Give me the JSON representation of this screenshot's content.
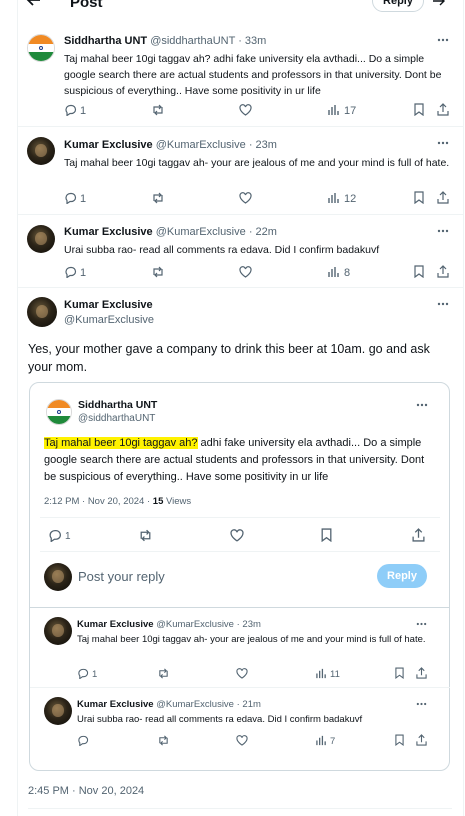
{
  "header": {
    "title": "Post",
    "reply_button": "Reply"
  },
  "tweets": [
    {
      "name": "Siddhartha UNT",
      "handle": "@siddharthaUNT",
      "time": "· 33m",
      "text": "Taj mahal beer 10gi taggav ah? adhi fake university ela avthadi... Do a simple google search there are actual students and professors in that university. Dont be suspicious of everything..  Have some positivity in ur life",
      "replies": "1",
      "views": "17"
    },
    {
      "name": "Kumar Exclusive",
      "handle": "@KumarExclusive",
      "time": "· 23m",
      "text": "Taj mahal beer 10gi taggav ah- your are jealous of me and your mind is full of hate.",
      "replies": "1",
      "views": "12"
    },
    {
      "name": "Kumar Exclusive",
      "handle": "@KumarExclusive",
      "time": "· 22m",
      "text": "Urai subba rao- read all comments ra edava. Did I confirm badakuvf",
      "replies": "1",
      "views": "8"
    }
  ],
  "main_post": {
    "name": "Kumar Exclusive",
    "handle": "@KumarExclusive",
    "text": "Yes, your mother gave a company to drink this beer at 10am. go and ask your mom.",
    "timestamp": "2:45 PM · Nov 20, 2024"
  },
  "quoted": {
    "name": "Siddhartha UNT",
    "handle": "@siddharthaUNT",
    "highlight": "Taj mahal beer 10gi taggav ah?",
    "text_rest": " adhi fake university ela avthadi... Do a simple google search there are actual students and professors in that university. Dont be suspicious of everything..  Have some positivity in ur life",
    "time": "2:12 PM · Nov 20, 2024 · ",
    "views_count": "15",
    "views_label": " Views",
    "replies": "1",
    "reply_placeholder": "Post your reply",
    "reply_button": "Reply"
  },
  "nested_replies": [
    {
      "name": "Kumar Exclusive",
      "handle": "@KumarExclusive",
      "time": "· 23m",
      "text": "Taj mahal beer 10gi taggav ah- your are jealous of me and your mind is full of hate.",
      "replies": "1",
      "views": "11"
    },
    {
      "name": "Kumar Exclusive",
      "handle": "@KumarExclusive",
      "time": "· 21m",
      "text": "Urai subba rao- read all comments ra edava. Did I confirm badakuvf",
      "views": "7"
    }
  ],
  "colors": {
    "text": "#0f1419",
    "muted": "#536471",
    "border": "#cfd9de",
    "reply_button_disabled": "#8ecdf8",
    "highlight": "#fff200",
    "saffron": "#f08a24",
    "green": "#1f8a3b"
  }
}
